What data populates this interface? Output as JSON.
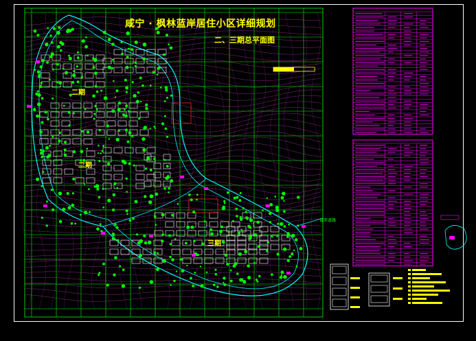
{
  "plan": {
    "title": "咸宁 · 枫林蓝岸居住小区详细规划",
    "subtitle": "二、三期总平面图",
    "phase_labels": [
      "二期",
      "二期",
      "三期"
    ],
    "road_label": "城市道路"
  },
  "colors": {
    "background": "#000000",
    "frame": "#ffffff",
    "grid": "#00ff00",
    "contour": "#ff44ff",
    "road": "#00ffff",
    "building": "#ffffff",
    "tree": "#00ff00",
    "title": "#ffff00",
    "table": "#ff00ff"
  }
}
